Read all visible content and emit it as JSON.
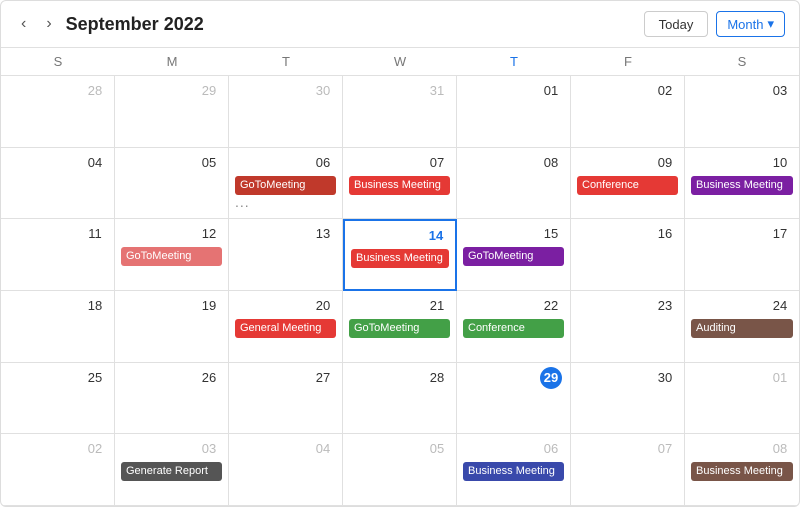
{
  "header": {
    "prev_label": "‹",
    "next_label": "›",
    "title": "September 2022",
    "today_label": "Today",
    "month_label": "Month",
    "chevron": "▾"
  },
  "day_names": [
    "S",
    "M",
    "T",
    "W",
    "T",
    "F",
    "S"
  ],
  "cells": [
    {
      "date": "28",
      "outside": true,
      "events": []
    },
    {
      "date": "29",
      "outside": true,
      "events": []
    },
    {
      "date": "30",
      "outside": true,
      "events": []
    },
    {
      "date": "31",
      "outside": true,
      "events": []
    },
    {
      "date": "01",
      "outside": false,
      "events": []
    },
    {
      "date": "02",
      "outside": false,
      "events": []
    },
    {
      "date": "03",
      "outside": false,
      "events": []
    },
    {
      "date": "04",
      "outside": false,
      "events": []
    },
    {
      "date": "05",
      "outside": false,
      "events": []
    },
    {
      "date": "06",
      "outside": false,
      "events": [
        {
          "label": "GoToMeeting",
          "color": "goto"
        },
        {
          "more": "..."
        }
      ]
    },
    {
      "date": "07",
      "outside": false,
      "events": [
        {
          "label": "Business Meeting",
          "color": "business"
        }
      ]
    },
    {
      "date": "08",
      "outside": false,
      "events": []
    },
    {
      "date": "09",
      "outside": false,
      "events": [
        {
          "label": "Conference",
          "color": "conference"
        }
      ]
    },
    {
      "date": "10",
      "outside": false,
      "events": [
        {
          "label": "Business Meeting",
          "color": "purple"
        }
      ]
    },
    {
      "date": "11",
      "outside": false,
      "events": []
    },
    {
      "date": "12",
      "outside": false,
      "events": [
        {
          "label": "GoToMeeting",
          "color": "goto-pink"
        }
      ]
    },
    {
      "date": "13",
      "outside": false,
      "events": []
    },
    {
      "date": "14",
      "outside": false,
      "selected": true,
      "events": [
        {
          "label": "Business Meeting",
          "color": "business"
        }
      ]
    },
    {
      "date": "15",
      "outside": false,
      "events": [
        {
          "label": "GoToMeeting",
          "color": "goto-purple"
        }
      ]
    },
    {
      "date": "16",
      "outside": false,
      "events": []
    },
    {
      "date": "17",
      "outside": false,
      "events": []
    },
    {
      "date": "18",
      "outside": false,
      "events": []
    },
    {
      "date": "19",
      "outside": false,
      "events": []
    },
    {
      "date": "20",
      "outside": false,
      "events": [
        {
          "label": "General Meeting",
          "color": "general"
        }
      ]
    },
    {
      "date": "21",
      "outside": false,
      "events": [
        {
          "label": "GoToMeeting",
          "color": "goto-green"
        }
      ]
    },
    {
      "date": "22",
      "outside": false,
      "events": [
        {
          "label": "Conference",
          "color": "conference2"
        }
      ]
    },
    {
      "date": "23",
      "outside": false,
      "events": []
    },
    {
      "date": "24",
      "outside": false,
      "events": [
        {
          "label": "Auditing",
          "color": "brown"
        }
      ]
    },
    {
      "date": "25",
      "outside": false,
      "events": []
    },
    {
      "date": "26",
      "outside": false,
      "events": []
    },
    {
      "date": "27",
      "outside": false,
      "events": []
    },
    {
      "date": "28",
      "outside": false,
      "events": []
    },
    {
      "date": "29",
      "outside": false,
      "today": true,
      "events": []
    },
    {
      "date": "30",
      "outside": false,
      "events": []
    },
    {
      "date": "01",
      "outside": true,
      "events": []
    },
    {
      "date": "02",
      "outside": true,
      "events": []
    },
    {
      "date": "03",
      "outside": true,
      "events": []
    },
    {
      "date": "04",
      "outside": true,
      "events": []
    },
    {
      "date": "05",
      "outside": true,
      "events": []
    },
    {
      "date": "06",
      "outside": true,
      "events": [
        {
          "label": "Business Meeting",
          "color": "goto-blue"
        }
      ]
    },
    {
      "date": "07",
      "outside": true,
      "events": []
    },
    {
      "date": "08",
      "outside": true,
      "events": [
        {
          "label": "Business Meeting",
          "color": "brown"
        }
      ]
    }
  ],
  "special": {
    "row2_03": {
      "label": "Generate Report",
      "color": "generate"
    }
  }
}
